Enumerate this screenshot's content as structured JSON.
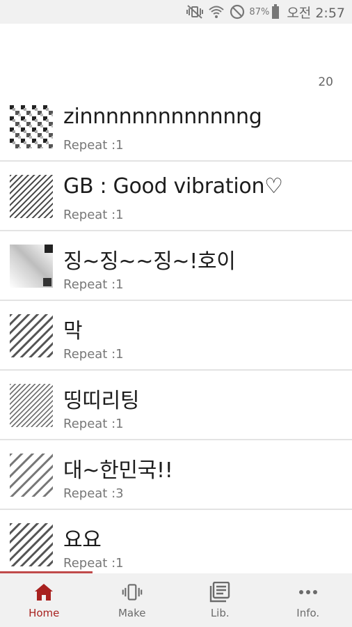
{
  "status_bar": {
    "battery_percent": "87%",
    "time": "오전 2:57"
  },
  "list": {
    "count": "20",
    "items": [
      {
        "title": "zinnnnnnnnnnnnng",
        "repeat": "Repeat :1",
        "pattern": "checker"
      },
      {
        "title": "GB : Good vibration♡",
        "repeat": "Repeat :1",
        "pattern": "dense"
      },
      {
        "title": "징~징~~징~!호이",
        "repeat": "Repeat :1",
        "pattern": "fade"
      },
      {
        "title": "막",
        "repeat": "Repeat :1",
        "pattern": "diagonal"
      },
      {
        "title": "띵띠리팅",
        "repeat": "Repeat :1",
        "pattern": "fine"
      },
      {
        "title": "대~한민국!!",
        "repeat": "Repeat :3",
        "pattern": "wide"
      },
      {
        "title": "요요",
        "repeat": "Repeat :1",
        "pattern": "diagonal"
      }
    ]
  },
  "nav": {
    "items": [
      {
        "label": "Home",
        "icon": "home-icon",
        "active": true
      },
      {
        "label": "Make",
        "icon": "vibrate-icon",
        "active": false
      },
      {
        "label": "Lib.",
        "icon": "library-icon",
        "active": false
      },
      {
        "label": "Info.",
        "icon": "more-icon",
        "active": false
      }
    ]
  },
  "colors": {
    "accent": "#a8211f",
    "nav_bg": "#f1f1f1",
    "divider": "#e3e3e3"
  }
}
